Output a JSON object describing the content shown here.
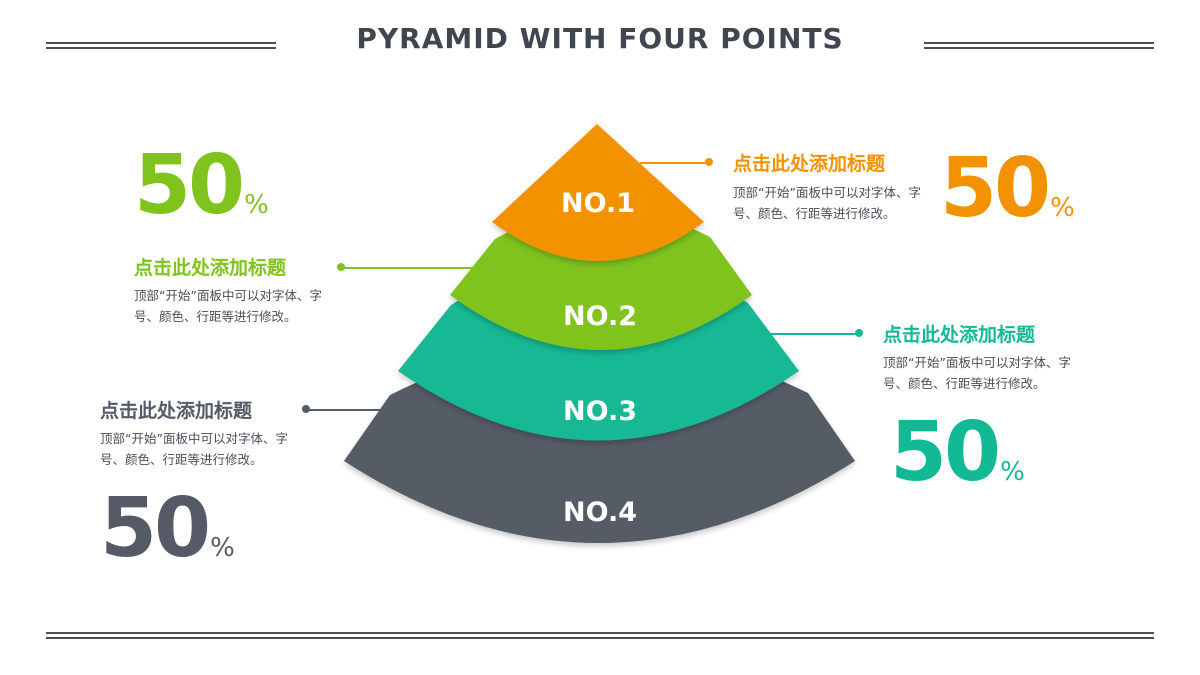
{
  "title": "PYRAMID WITH FOUR POINTS",
  "colors": {
    "orange": "#f39200",
    "green": "#7fc31c",
    "teal": "#13b994",
    "gray": "#545b66",
    "rule": "#4a4f57"
  },
  "tiers": [
    {
      "label": "NO.1"
    },
    {
      "label": "NO.2"
    },
    {
      "label": "NO.3"
    },
    {
      "label": "NO.4"
    }
  ],
  "points": [
    {
      "number": "50",
      "unit": "%",
      "heading": "点击此处添加标题",
      "desc": "顶部“开始”面板中可以对字体、字号、颜色、行距等进行修改。"
    },
    {
      "number": "50",
      "unit": "%",
      "heading": "点击此处添加标题",
      "desc": "顶部“开始”面板中可以对字体、字号、颜色、行距等进行修改。"
    },
    {
      "number": "50",
      "unit": "%",
      "heading": "点击此处添加标题",
      "desc": "顶部“开始”面板中可以对字体、字号、颜色、行距等进行修改。"
    },
    {
      "number": "50",
      "unit": "%",
      "heading": "点击此处添加标题",
      "desc": "顶部“开始”面板中可以对字体、字号、颜色、行距等进行修改。"
    }
  ]
}
